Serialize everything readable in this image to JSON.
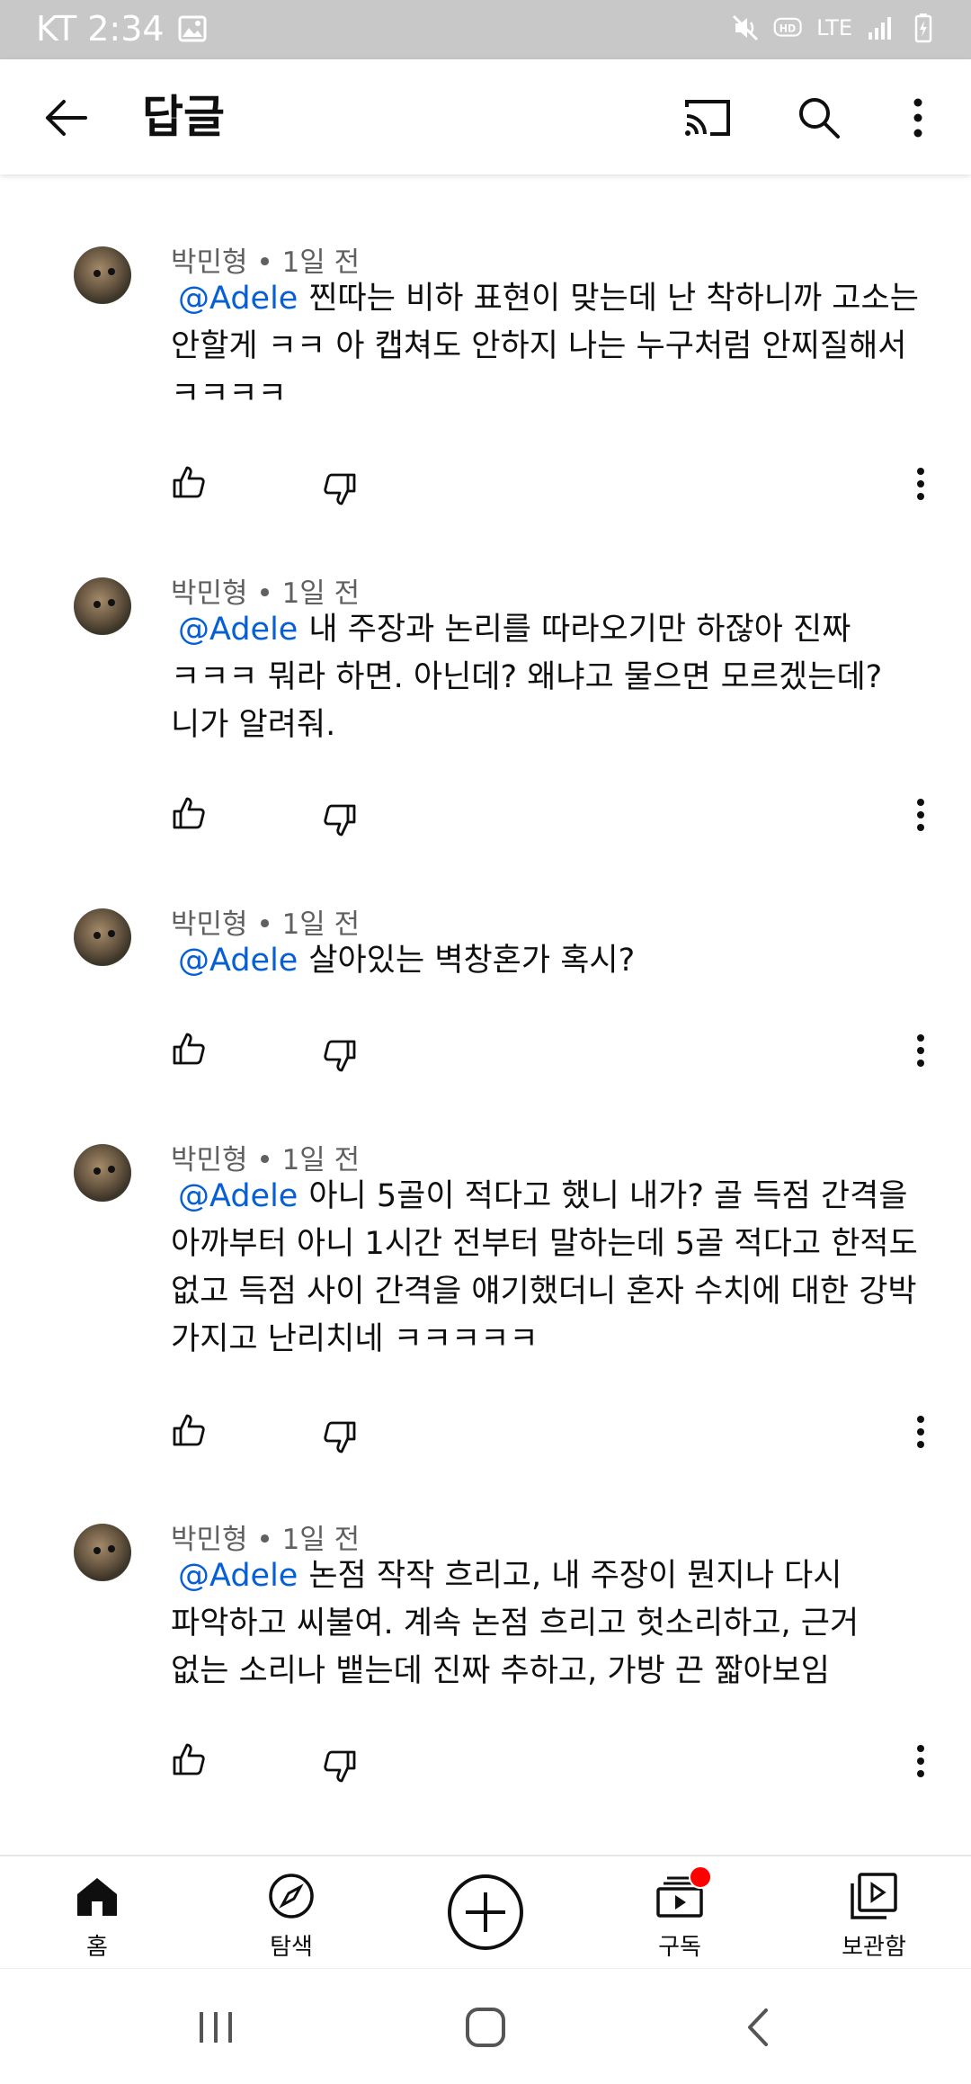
{
  "status_bar": {
    "carrier_time": "KT 2:34",
    "network": "LTE"
  },
  "app_bar": {
    "title": "답글"
  },
  "comments": [
    {
      "author": "박민형",
      "time": "1일 전",
      "mention": "@Adele",
      "text": "찐따는 비하 표현이 맞는데 난 착하니까 고소는 안할게 ㅋㅋ 아 캡쳐도 안하지 나는 누구처럼 안찌질해서 ㅋㅋㅋㅋ"
    },
    {
      "author": "박민형",
      "time": "1일 전",
      "mention": "@Adele",
      "text": "내 주장과 논리를 따라오기만 하잖아 진짜 ㅋㅋㅋ 뭐라 하면. 아닌데? 왜냐고 물으면 모르겠는데? 니가 알려줘."
    },
    {
      "author": "박민형",
      "time": "1일 전",
      "mention": "@Adele",
      "text": "살아있는 벽창혼가 혹시?"
    },
    {
      "author": "박민형",
      "time": "1일 전",
      "mention": "@Adele",
      "text": "아니 5골이 적다고 했니 내가? 골 득점 간격을 아까부터 아니 1시간 전부터 말하는데 5골 적다고 한적도 없고 득점 사이 간격을 얘기했더니 혼자 수치에 대한 강박 가지고 난리치네 ㅋㅋㅋㅋㅋ"
    },
    {
      "author": "박민형",
      "time": "1일 전",
      "mention": "@Adele",
      "text": "논점 작작 흐리고, 내 주장이 뭔지나 다시 파악하고 씨불여. 계속 논점 흐리고 헛소리하고, 근거 없는 소리나 뱉는데 진짜 추하고, 가방 끈 짧아보임"
    }
  ],
  "bottom_nav": {
    "home": "홈",
    "explore": "탐색",
    "subscriptions": "구독",
    "library": "보관함"
  },
  "colors": {
    "mention": "#065fd4",
    "meta": "#606060",
    "status_bar": "#c8c8c8",
    "notification_dot": "#ff0000"
  }
}
